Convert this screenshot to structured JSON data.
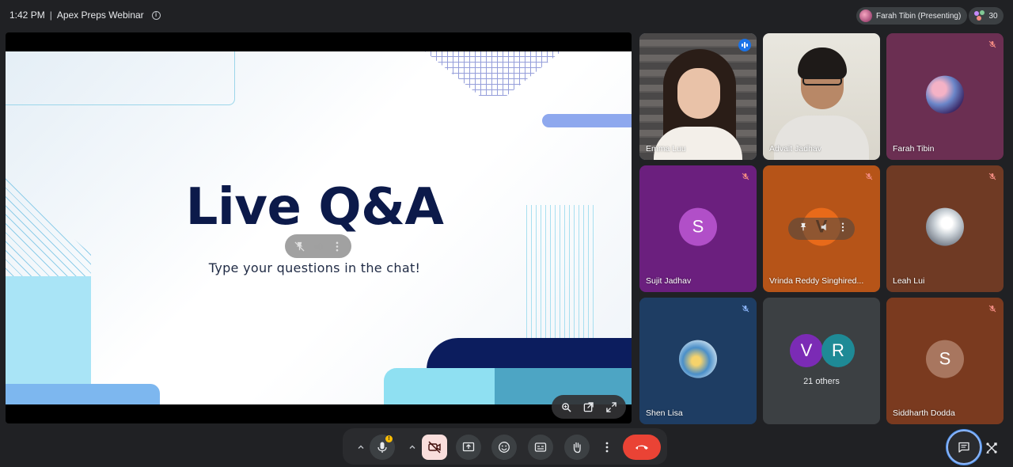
{
  "header": {
    "time": "1:42 PM",
    "separator": "|",
    "meeting_title": "Apex Preps Webinar",
    "info_glyph": "i",
    "presenting_label": "Farah Tibin (Presenting)",
    "participant_count": "30"
  },
  "slide": {
    "title": "Live Q&A",
    "subtitle": "Type your questions in the chat!"
  },
  "tiles": [
    {
      "name": "Emma Luu",
      "state": "speaking",
      "bg": "#4b4a4a"
    },
    {
      "name": "Advait Jadhav",
      "state": "video",
      "bg": "#dcd8ce"
    },
    {
      "name": "Farah Tibin",
      "state": "muted",
      "bg": "#6b2f52"
    },
    {
      "name": "Sujit Jadhav",
      "state": "muted",
      "initial": "S",
      "bg": "#6b1f7e",
      "avatar_color": "#b14fc8"
    },
    {
      "name": "Vrinda Reddy Singhired...",
      "state": "muted",
      "initial": "V",
      "bg": "#b65418"
    },
    {
      "name": "Leah Lui",
      "state": "muted",
      "bg": "#6f3a24"
    },
    {
      "name": "Shen Lisa",
      "state": "muted",
      "bg": "#1e3d63"
    },
    {
      "name": "",
      "state": "others",
      "bg": "#3c4043"
    },
    {
      "name": "Siddharth Dodda",
      "state": "muted",
      "initial": "S",
      "bg": "#7a3a1f",
      "avatar_color": "#a8765f"
    }
  ],
  "others": {
    "avatars": [
      {
        "initial": "V",
        "color": "#7b2bb5"
      },
      {
        "initial": "R",
        "color": "#1e8a96"
      }
    ],
    "label": "21 others"
  },
  "icons": {
    "mute": "mic-off-icon",
    "speaking": "audio-level-icon",
    "mic": "mic-icon",
    "camera_off": "camera-off-icon",
    "present": "present-screen-icon",
    "emoji": "emoji-icon",
    "captions": "captions-icon",
    "raise_hand": "raise-hand-icon",
    "more": "more-vert-icon",
    "end_call": "end-call-icon",
    "chat": "chat-icon",
    "activities": "activities-icon"
  },
  "colors": {
    "background": "#202124",
    "accent": "#8ab4f8",
    "end_call": "#ea4335",
    "mute_badge": "#d93025",
    "warning": "#fbbc04"
  }
}
